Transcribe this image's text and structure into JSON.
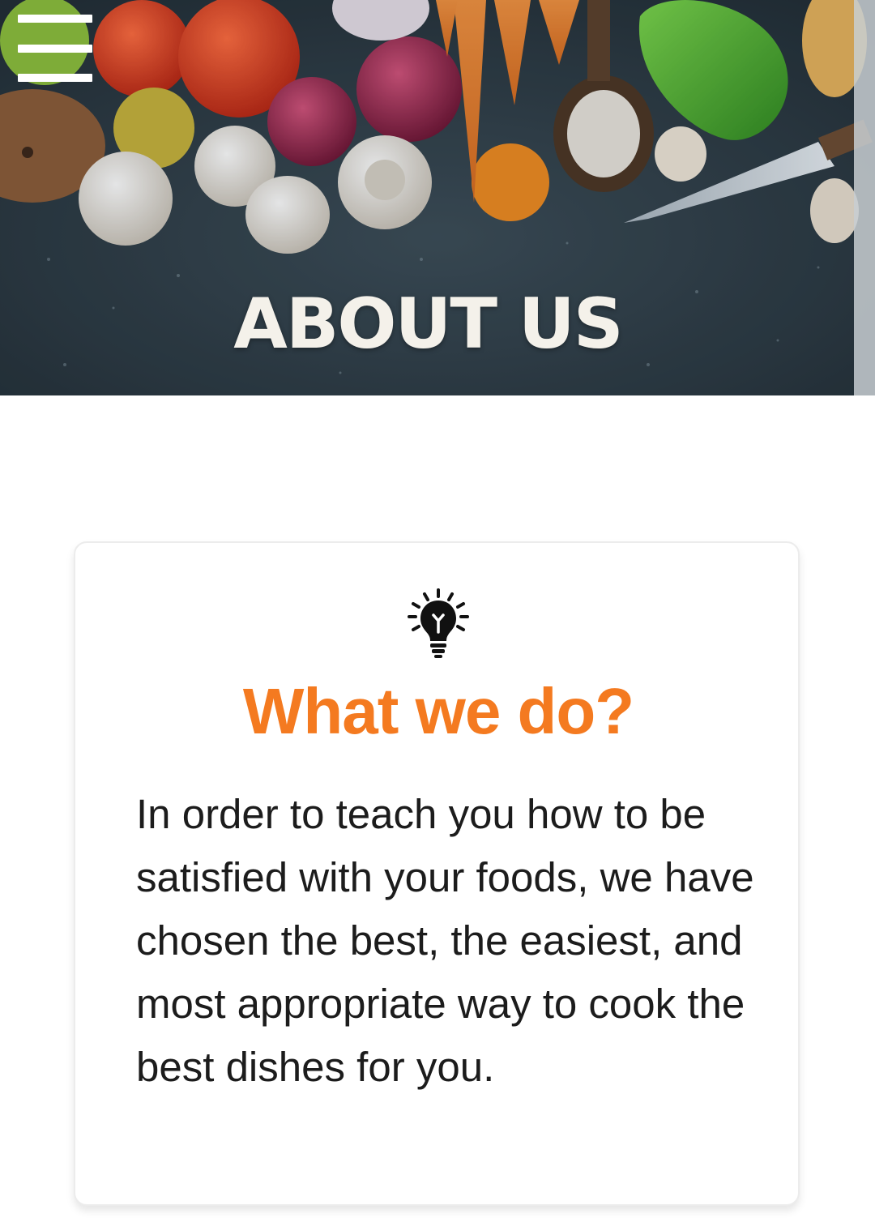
{
  "hero": {
    "title": "ABOUT US"
  },
  "menu": {
    "icon": "hamburger-menu-icon"
  },
  "card": {
    "icon": "lightbulb-icon",
    "title": "What we do?",
    "body": "In order to teach you how to be satisfied with your foods, we have chosen the best, the easiest, and most appropriate way to cook the best dishes for you."
  },
  "colors": {
    "accent": "#f47a20",
    "body_text": "#1c1c1c",
    "hero_overlay": "#2a3a44"
  }
}
